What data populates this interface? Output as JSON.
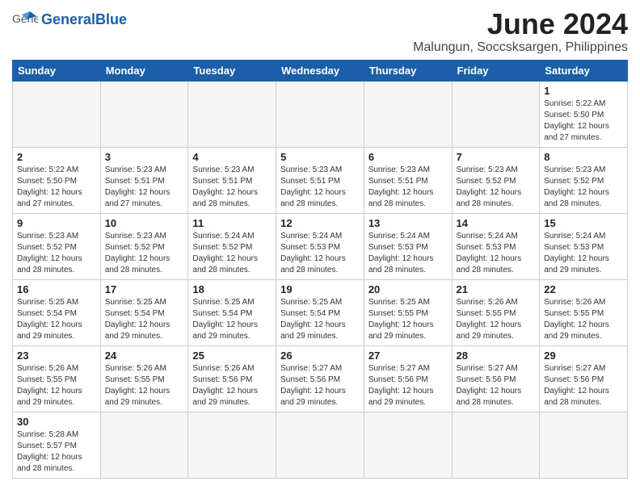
{
  "header": {
    "logo_general": "General",
    "logo_blue": "Blue",
    "title": "June 2024",
    "location": "Malungun, Soccsksargen, Philippines"
  },
  "weekdays": [
    "Sunday",
    "Monday",
    "Tuesday",
    "Wednesday",
    "Thursday",
    "Friday",
    "Saturday"
  ],
  "rows": [
    [
      {
        "day": "",
        "info": ""
      },
      {
        "day": "",
        "info": ""
      },
      {
        "day": "",
        "info": ""
      },
      {
        "day": "",
        "info": ""
      },
      {
        "day": "",
        "info": ""
      },
      {
        "day": "",
        "info": ""
      },
      {
        "day": "1",
        "info": "Sunrise: 5:22 AM\nSunset: 5:50 PM\nDaylight: 12 hours and 27 minutes."
      }
    ],
    [
      {
        "day": "2",
        "info": "Sunrise: 5:22 AM\nSunset: 5:50 PM\nDaylight: 12 hours and 27 minutes."
      },
      {
        "day": "3",
        "info": "Sunrise: 5:23 AM\nSunset: 5:51 PM\nDaylight: 12 hours and 27 minutes."
      },
      {
        "day": "4",
        "info": "Sunrise: 5:23 AM\nSunset: 5:51 PM\nDaylight: 12 hours and 28 minutes."
      },
      {
        "day": "5",
        "info": "Sunrise: 5:23 AM\nSunset: 5:51 PM\nDaylight: 12 hours and 28 minutes."
      },
      {
        "day": "6",
        "info": "Sunrise: 5:23 AM\nSunset: 5:51 PM\nDaylight: 12 hours and 28 minutes."
      },
      {
        "day": "7",
        "info": "Sunrise: 5:23 AM\nSunset: 5:52 PM\nDaylight: 12 hours and 28 minutes."
      },
      {
        "day": "8",
        "info": "Sunrise: 5:23 AM\nSunset: 5:52 PM\nDaylight: 12 hours and 28 minutes."
      }
    ],
    [
      {
        "day": "9",
        "info": "Sunrise: 5:23 AM\nSunset: 5:52 PM\nDaylight: 12 hours and 28 minutes."
      },
      {
        "day": "10",
        "info": "Sunrise: 5:23 AM\nSunset: 5:52 PM\nDaylight: 12 hours and 28 minutes."
      },
      {
        "day": "11",
        "info": "Sunrise: 5:24 AM\nSunset: 5:52 PM\nDaylight: 12 hours and 28 minutes."
      },
      {
        "day": "12",
        "info": "Sunrise: 5:24 AM\nSunset: 5:53 PM\nDaylight: 12 hours and 28 minutes."
      },
      {
        "day": "13",
        "info": "Sunrise: 5:24 AM\nSunset: 5:53 PM\nDaylight: 12 hours and 28 minutes."
      },
      {
        "day": "14",
        "info": "Sunrise: 5:24 AM\nSunset: 5:53 PM\nDaylight: 12 hours and 28 minutes."
      },
      {
        "day": "15",
        "info": "Sunrise: 5:24 AM\nSunset: 5:53 PM\nDaylight: 12 hours and 29 minutes."
      }
    ],
    [
      {
        "day": "16",
        "info": "Sunrise: 5:25 AM\nSunset: 5:54 PM\nDaylight: 12 hours and 29 minutes."
      },
      {
        "day": "17",
        "info": "Sunrise: 5:25 AM\nSunset: 5:54 PM\nDaylight: 12 hours and 29 minutes."
      },
      {
        "day": "18",
        "info": "Sunrise: 5:25 AM\nSunset: 5:54 PM\nDaylight: 12 hours and 29 minutes."
      },
      {
        "day": "19",
        "info": "Sunrise: 5:25 AM\nSunset: 5:54 PM\nDaylight: 12 hours and 29 minutes."
      },
      {
        "day": "20",
        "info": "Sunrise: 5:25 AM\nSunset: 5:55 PM\nDaylight: 12 hours and 29 minutes."
      },
      {
        "day": "21",
        "info": "Sunrise: 5:26 AM\nSunset: 5:55 PM\nDaylight: 12 hours and 29 minutes."
      },
      {
        "day": "22",
        "info": "Sunrise: 5:26 AM\nSunset: 5:55 PM\nDaylight: 12 hours and 29 minutes."
      }
    ],
    [
      {
        "day": "23",
        "info": "Sunrise: 5:26 AM\nSunset: 5:55 PM\nDaylight: 12 hours and 29 minutes."
      },
      {
        "day": "24",
        "info": "Sunrise: 5:26 AM\nSunset: 5:55 PM\nDaylight: 12 hours and 29 minutes."
      },
      {
        "day": "25",
        "info": "Sunrise: 5:26 AM\nSunset: 5:56 PM\nDaylight: 12 hours and 29 minutes."
      },
      {
        "day": "26",
        "info": "Sunrise: 5:27 AM\nSunset: 5:56 PM\nDaylight: 12 hours and 29 minutes."
      },
      {
        "day": "27",
        "info": "Sunrise: 5:27 AM\nSunset: 5:56 PM\nDaylight: 12 hours and 29 minutes."
      },
      {
        "day": "28",
        "info": "Sunrise: 5:27 AM\nSunset: 5:56 PM\nDaylight: 12 hours and 28 minutes."
      },
      {
        "day": "29",
        "info": "Sunrise: 5:27 AM\nSunset: 5:56 PM\nDaylight: 12 hours and 28 minutes."
      }
    ],
    [
      {
        "day": "30",
        "info": "Sunrise: 5:28 AM\nSunset: 5:57 PM\nDaylight: 12 hours and 28 minutes."
      },
      {
        "day": "",
        "info": ""
      },
      {
        "day": "",
        "info": ""
      },
      {
        "day": "",
        "info": ""
      },
      {
        "day": "",
        "info": ""
      },
      {
        "day": "",
        "info": ""
      },
      {
        "day": "",
        "info": ""
      }
    ]
  ]
}
